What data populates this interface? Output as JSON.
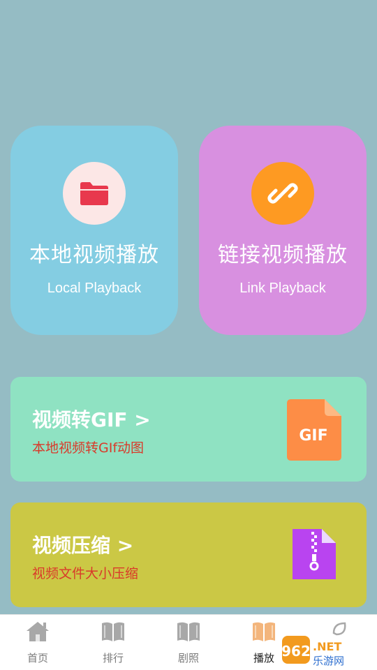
{
  "cards": {
    "local": {
      "title": "本地视频播放",
      "subtitle": "Local Playback",
      "icon": "folder-icon",
      "color": "#84cde2"
    },
    "link": {
      "title": "链接视频播放",
      "subtitle": "Link Playback",
      "icon": "link-icon",
      "color": "#d890e0"
    }
  },
  "tools": {
    "gif": {
      "title": "视频转GIF >",
      "subtitle": "本地视频转GIf动图",
      "icon": "gif-file-icon",
      "icon_text": "GIF"
    },
    "compress": {
      "title": "视频压缩 >",
      "subtitle": "视频文件大小压缩",
      "icon": "zip-file-icon"
    }
  },
  "tabbar": {
    "items": [
      {
        "label": "首页",
        "icon": "home-icon",
        "active": false
      },
      {
        "label": "排行",
        "icon": "book-icon",
        "active": false
      },
      {
        "label": "剧照",
        "icon": "book-icon",
        "active": false
      },
      {
        "label": "播放",
        "icon": "book-icon",
        "active": true
      },
      {
        "label": "",
        "icon": "leaf-icon",
        "active": false
      }
    ]
  },
  "watermark": {
    "number": "962",
    "suffix": ".NET",
    "text": "乐游网"
  }
}
